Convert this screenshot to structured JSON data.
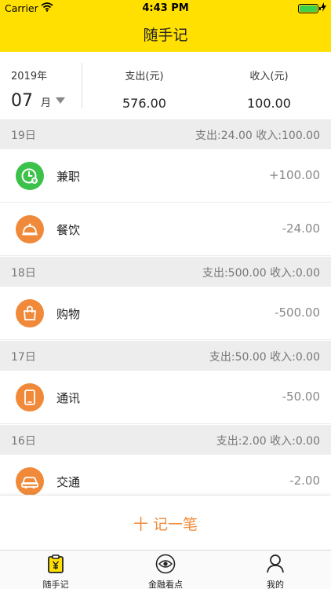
{
  "status_bar": {
    "carrier": "Carrier",
    "time": "4:43 PM"
  },
  "nav": {
    "title": "随手记"
  },
  "summary": {
    "year": "2019年",
    "month": "07",
    "month_unit": "月",
    "expense_label": "支出(元)",
    "expense_value": "576.00",
    "income_label": "收入(元)",
    "income_value": "100.00"
  },
  "days": [
    {
      "date": "19日",
      "totals": "支出:24.00 收入:100.00",
      "items": [
        {
          "icon": "clock-icon",
          "color": "#3cc24a",
          "label": "兼职",
          "amount": "+100.00"
        },
        {
          "icon": "dining-icon",
          "color": "#f08a3a",
          "label": "餐饮",
          "amount": "-24.00"
        }
      ]
    },
    {
      "date": "18日",
      "totals": "支出:500.00 收入:0.00",
      "items": [
        {
          "icon": "shopping-bag-icon",
          "color": "#f08a3a",
          "label": "购物",
          "amount": "-500.00"
        }
      ]
    },
    {
      "date": "17日",
      "totals": "支出:50.00 收入:0.00",
      "items": [
        {
          "icon": "phone-icon",
          "color": "#f08a3a",
          "label": "通讯",
          "amount": "-50.00"
        }
      ]
    },
    {
      "date": "16日",
      "totals": "支出:2.00 收入:0.00",
      "items": [
        {
          "icon": "car-icon",
          "color": "#f08a3a",
          "label": "交通",
          "amount": "-2.00"
        }
      ]
    }
  ],
  "add_button": {
    "label": "十 记一笔"
  },
  "tabs": [
    {
      "label": "随手记",
      "icon": "clipboard-yen-icon"
    },
    {
      "label": "金融看点",
      "icon": "eye-icon"
    },
    {
      "label": "我的",
      "icon": "person-icon"
    }
  ],
  "colors": {
    "header": "#ffe000",
    "accent": "#f08a3a",
    "income_icon": "#3cc24a"
  }
}
